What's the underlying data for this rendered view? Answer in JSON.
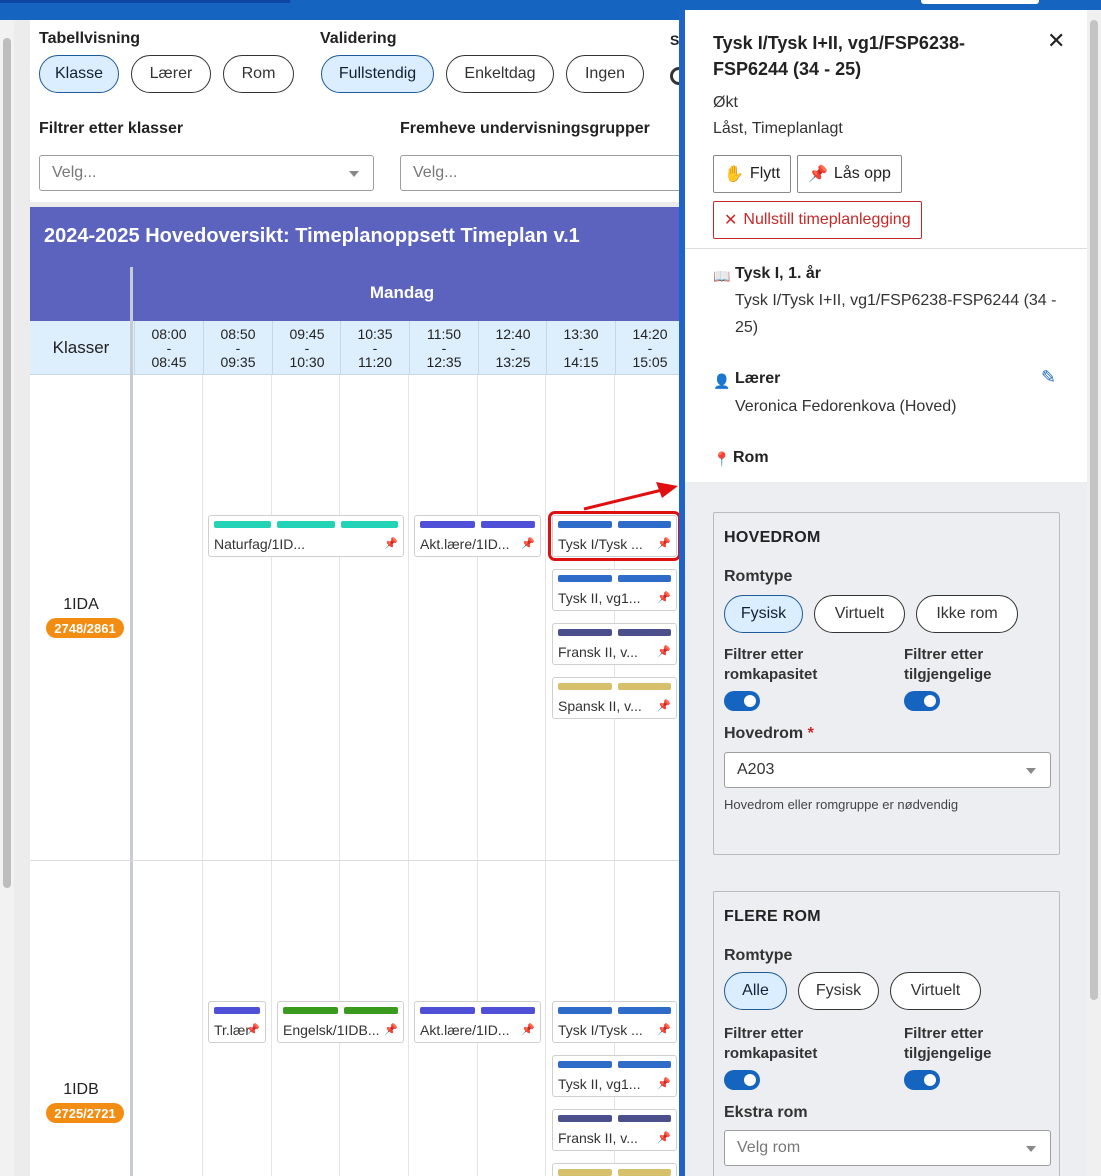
{
  "filters": {
    "tabellvisning_label": "Tabellvisning",
    "tabellvisning_options": [
      "Klasse",
      "Lærer",
      "Rom"
    ],
    "validering_label": "Validering",
    "validering_options": [
      "Fullstendig",
      "Enkeltdag",
      "Ingen"
    ],
    "partial_label": "S",
    "filtrer_klasser_label": "Filtrer etter klasser",
    "filtrer_klasser_placeholder": "Velg...",
    "fremheve_label": "Fremheve undervisningsgrupper",
    "fremheve_placeholder": "Velg..."
  },
  "grid": {
    "title": "2024-2025 Hovedoversikt: Timeplanoppsett Timeplan v.1",
    "day": "Mandag",
    "klasser_label": "Klasser",
    "slots": [
      {
        "start": "08:00",
        "end": "08:45"
      },
      {
        "start": "08:50",
        "end": "09:35"
      },
      {
        "start": "09:45",
        "end": "10:30"
      },
      {
        "start": "10:35",
        "end": "11:20"
      },
      {
        "start": "11:50",
        "end": "12:35"
      },
      {
        "start": "12:40",
        "end": "13:25"
      },
      {
        "start": "13:30",
        "end": "14:15"
      },
      {
        "start": "14:20",
        "end": "15:05"
      }
    ],
    "classes": [
      {
        "name": "1IDA",
        "badge": "2748/2861"
      },
      {
        "name": "1IDB",
        "badge": "2725/2721"
      }
    ],
    "lessons_1ida": [
      {
        "label": "Naturfag/1ID..."
      },
      {
        "label": "Akt.lære/1ID..."
      },
      {
        "label": "Tysk I/Tysk ..."
      },
      {
        "label": "Tysk II, vg1..."
      },
      {
        "label": "Fransk II, v..."
      },
      {
        "label": "Spansk II, v..."
      }
    ],
    "lessons_1idb": [
      {
        "label": "Tr.lær"
      },
      {
        "label": "Engelsk/1IDB..."
      },
      {
        "label": "Akt.lære/1ID..."
      },
      {
        "label": "Tysk I/Tysk ..."
      },
      {
        "label": "Tysk II, vg1..."
      },
      {
        "label": "Fransk II, v..."
      }
    ],
    "colors": {
      "teal": "#22d3b6",
      "indigo": "#4f4fd8",
      "blue": "#2f6bc8",
      "purple": "#4b4f8c",
      "tan": "#d7c06c",
      "green": "#3a9a1e",
      "badge": "#f28c12"
    }
  },
  "panel": {
    "title": "Tysk I/Tysk I+II, vg1/FSP6238-FSP6244 (34 - 25)",
    "type": "Økt",
    "status": "Låst, Timeplanlagt",
    "flytt_label": "Flytt",
    "las_opp_label": "Lås opp",
    "nullstill_label": "Nullstill timeplanlegging",
    "course_title": "Tysk I, 1. år",
    "course_text": "Tysk I/Tysk I+II, vg1/FSP6238-FSP6244 (34 - 25)",
    "teacher_title": "Lærer",
    "teacher_text": "Veronica Fedorenkova (Hoved)",
    "room_title": "Rom",
    "hovedrom": {
      "title": "HOVEDROM",
      "romtype_label": "Romtype",
      "options": [
        "Fysisk",
        "Virtuelt",
        "Ikke rom"
      ],
      "filter_kapasitet": "Filtrer etter romkapasitet",
      "filter_tilgjengelige": "Filtrer etter tilgjengelige",
      "field_label": "Hovedrom",
      "required_mark": "*",
      "value": "A203",
      "hint": "Hovedrom eller romgruppe er nødvendig"
    },
    "flere_rom": {
      "title": "FLERE ROM",
      "romtype_label": "Romtype",
      "options": [
        "Alle",
        "Fysisk",
        "Virtuelt"
      ],
      "filter_kapasitet": "Filtrer etter romkapasitet",
      "filter_tilgjengelige": "Filtrer etter tilgjengelige",
      "field_label": "Ekstra rom",
      "placeholder": "Velg rom"
    }
  }
}
